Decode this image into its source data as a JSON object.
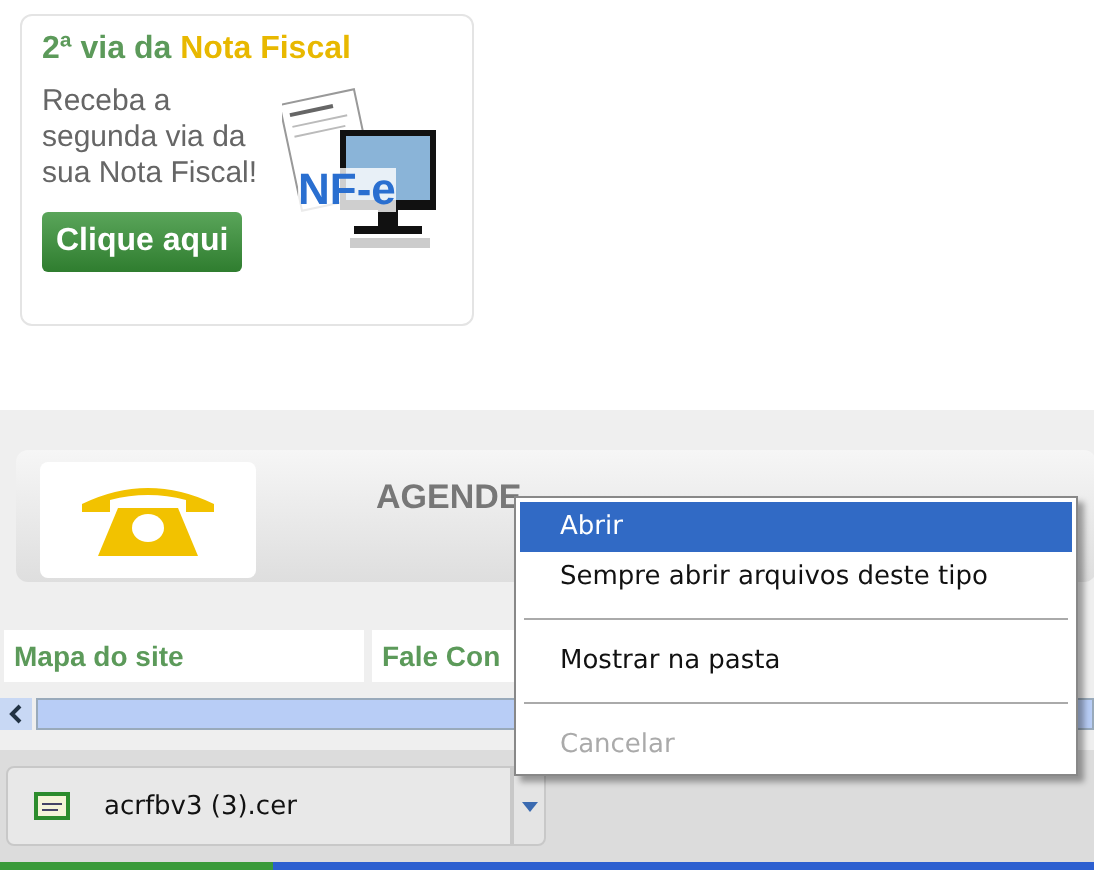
{
  "banner": {
    "title_start": "2ª via da",
    "title_highlight": "Nota Fiscal",
    "text": "Receba a segunda via da sua Nota Fiscal!",
    "button": "Clique aqui",
    "logo_text": "NF-e"
  },
  "phone_panel": {
    "heading": "AGENDE"
  },
  "footer_links": [
    "Mapa do site",
    "Fale Con"
  ],
  "context_menu": [
    {
      "kind": "item",
      "label": "Abrir",
      "selected": true,
      "disabled": false
    },
    {
      "kind": "item",
      "label": "Sempre abrir arquivos deste tipo",
      "selected": false,
      "disabled": false
    },
    {
      "kind": "separator"
    },
    {
      "kind": "item",
      "label": "Mostrar na pasta",
      "selected": false,
      "disabled": false
    },
    {
      "kind": "separator"
    },
    {
      "kind": "item",
      "label": "Cancelar",
      "selected": false,
      "disabled": true
    }
  ],
  "download_bar": {
    "file": "acrfbv3 (3).cer"
  }
}
